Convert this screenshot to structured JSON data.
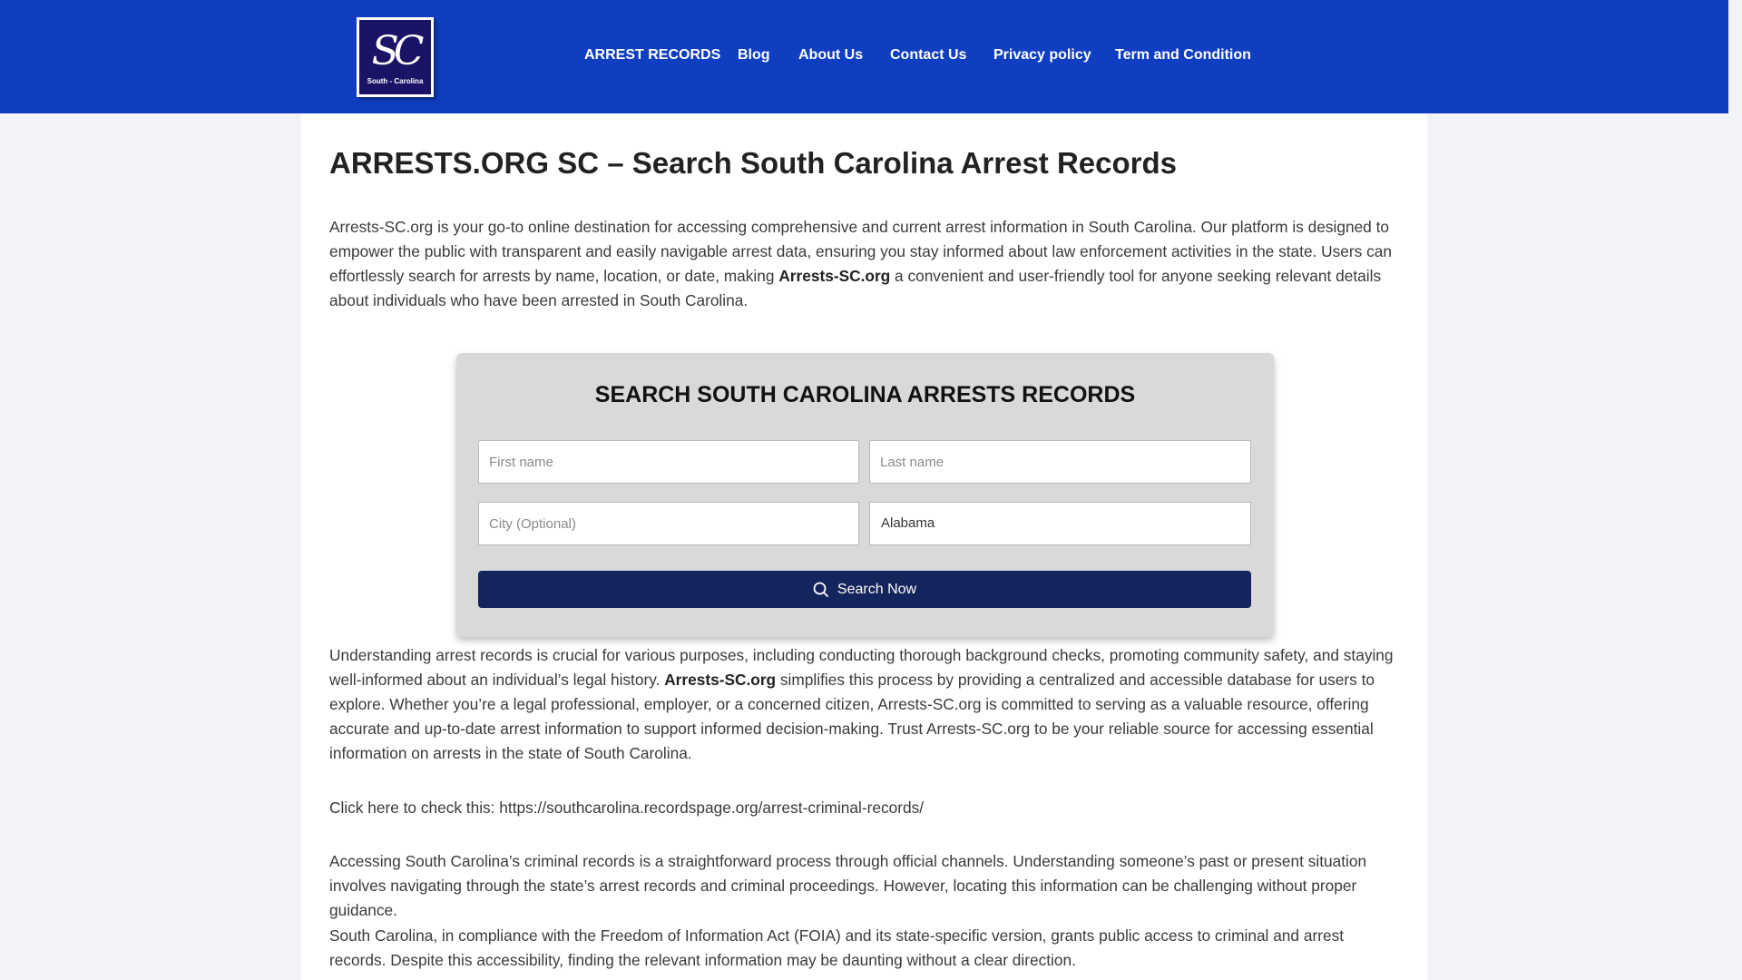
{
  "header": {
    "logo_text": "South - Carolina",
    "logo_mark": "SC",
    "nav": [
      {
        "label": "ARREST RECORDS"
      },
      {
        "label": "Blog"
      },
      {
        "label": "About Us"
      },
      {
        "label": "Contact Us"
      },
      {
        "label": "Privacy policy"
      },
      {
        "label": "Term and Condition"
      }
    ]
  },
  "main": {
    "title": "ARRESTS.ORG SC – Search South Carolina Arrest Records",
    "intro": {
      "before": "Arrests-SC.org is your go-to online destination for accessing comprehensive and current arrest information in South Carolina. Our platform is designed to empower the public with transparent and easily navigable arrest data, ensuring you stay informed about law enforcement activities in the state. Users can effortlessly search for arrests by name, location, or date, making ",
      "bold": "Arrests-SC.org",
      "after": " a convenient and user-friendly tool for anyone seeking relevant details about individuals who have been arrested in South Carolina."
    },
    "search": {
      "title": "SEARCH SOUTH CAROLINA ARRESTS RECORDS",
      "first_name_placeholder": "First name",
      "last_name_placeholder": "Last name",
      "city_placeholder": "City (Optional)",
      "state_value": "Alabama",
      "button_label": "Search Now"
    },
    "para2": {
      "before": "Understanding arrest records is crucial for various purposes, including conducting thorough background checks, promoting community safety, and staying well-informed about an individual’s legal history. ",
      "bold": "Arrests-SC.org",
      "after": " simplifies this process by providing a centralized and accessible database for users to explore. Whether you’re a legal professional, employer, or a concerned citizen, Arrests-SC.org is committed to serving as a valuable resource, offering accurate and up-to-date arrest information to support informed decision-making. Trust Arrests-SC.org to be your reliable source for accessing essential information on arrests in the state of South Carolina."
    },
    "para3": "Click here to check this: https://southcarolina.recordspage.org/arrest-criminal-records/",
    "para4": "Accessing South Carolina’s criminal records is a straightforward process through official channels. Understanding someone’s past or present situation involves navigating through the state’s arrest records and criminal proceedings. However, locating this information can be challenging without proper guidance.",
    "para5": "South Carolina, in compliance with the Freedom of Information Act (FOIA) and its state-specific version, grants public access to criminal and arrest records. Despite this accessibility, finding the relevant information may be daunting without a clear direction."
  },
  "colors": {
    "header_bg": "#0f3ec0",
    "button_bg": "#14245c",
    "search_box_bg": "#d9d9d9"
  },
  "icons": {
    "search_button": "search-icon"
  }
}
